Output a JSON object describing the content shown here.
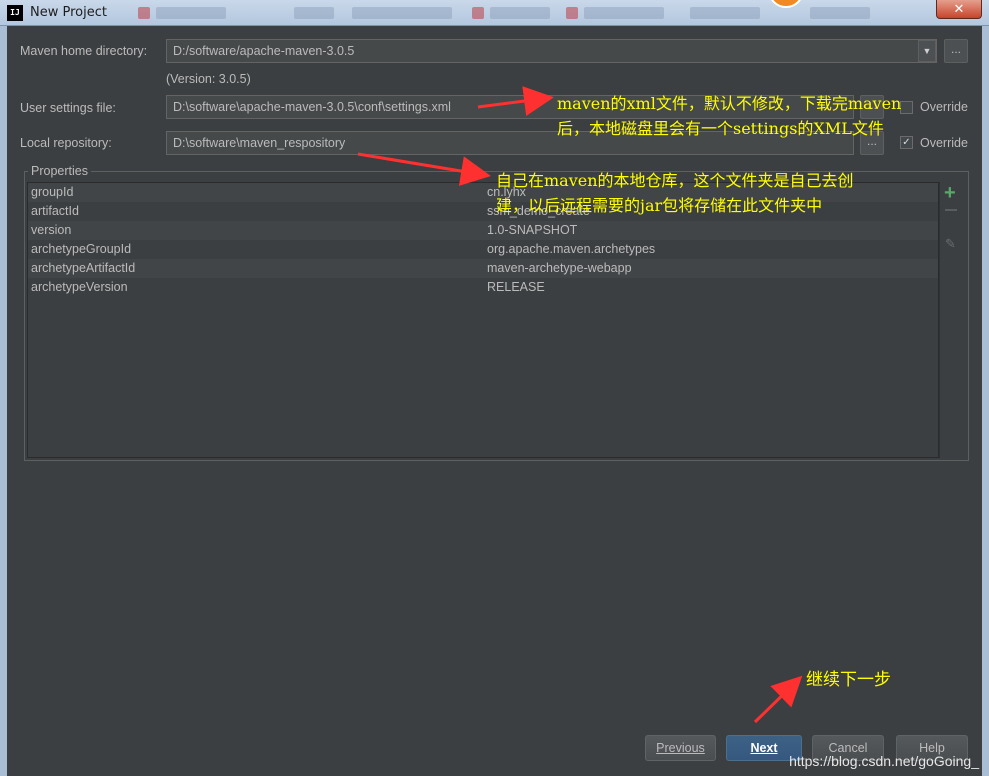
{
  "window": {
    "title": "New Project",
    "icon_text": "IJ",
    "close_glyph": "✕"
  },
  "maven_home": {
    "label": "Maven home directory:",
    "value": "D:/software/apache-maven-3.0.5",
    "version": "(Version: 3.0.5)",
    "dropdown_glyph": "▼",
    "browse_label": "..."
  },
  "user_settings": {
    "label": "User settings file:",
    "value": "D:\\software\\apache-maven-3.0.5\\conf\\settings.xml",
    "browse_label": "...",
    "override_label": "Override"
  },
  "local_repo": {
    "label": "Local repository:",
    "value": "D:\\software\\maven_respository",
    "browse_label": "...",
    "override_label": "Override",
    "override_checked": true
  },
  "properties": {
    "legend": "Properties",
    "rows": [
      {
        "key": "groupId",
        "value": "cn.lyhx"
      },
      {
        "key": "artifactId",
        "value": "ssm_demo_create"
      },
      {
        "key": "version",
        "value": "1.0-SNAPSHOT"
      },
      {
        "key": "archetypeGroupId",
        "value": "org.apache.maven.archetypes"
      },
      {
        "key": "archetypeArtifactId",
        "value": "maven-archetype-webapp"
      },
      {
        "key": "archetypeVersion",
        "value": "RELEASE"
      }
    ],
    "add_icon": "add-icon",
    "remove_icon": "remove-icon",
    "edit_icon": "edit-icon"
  },
  "buttons": {
    "previous": "Previous",
    "next": "Next",
    "cancel": "Cancel",
    "help": "Help"
  },
  "annotations": {
    "settings_line1": "maven的xml文件，默认不修改，下载完maven",
    "settings_line2": "后，本地磁盘里会有一个settings的XML文件",
    "repo_line1": "自己在maven的本地仓库，这个文件夹是自己去创",
    "repo_line2": "建，以后远程需要的jar包将存储在此文件夹中",
    "next_step": "继续下一步"
  },
  "watermark": "https://blog.csdn.net/goGoing_",
  "colors": {
    "background": "#3c3f41",
    "annotation": "#ffff00",
    "arrow": "#ff3030",
    "primary_button": "#365880"
  }
}
